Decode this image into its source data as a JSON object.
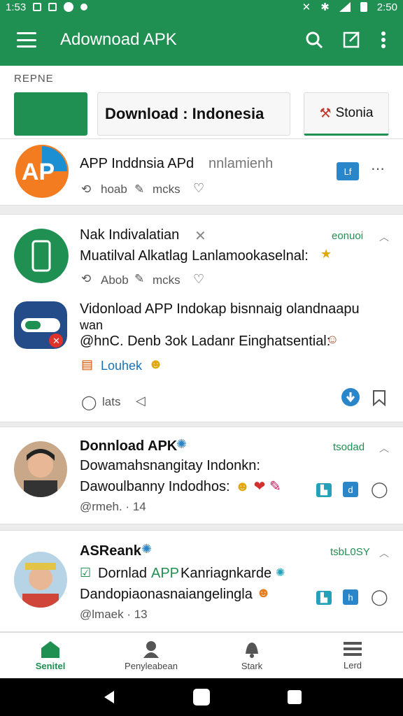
{
  "status_bar": {
    "time": "1:53",
    "clock_right": "2:50"
  },
  "app_bar": {
    "title": "Adownoad APK"
  },
  "section": {
    "label": "REPNE",
    "download_heading": "Download : Indonesia",
    "tab_label": "Stonia"
  },
  "posts": [
    {
      "title": "APP Inddnsia APd",
      "title_suffix": "nnlamienh",
      "meta_left": "hoab",
      "meta_right": "mcks",
      "badge": "Lf"
    },
    {
      "title": "Nak Indivalatian",
      "tag": "eonuoi",
      "body": "Muatilval Alkatlag Lanlamookaselnal:",
      "meta_left": "Abob",
      "meta_right": "mcks"
    },
    {
      "title": "Vidonload APP Indokap bisnnaig olandnaapu",
      "title_line2": "wan",
      "body": "@hnC. Denb 3ok Ladanr Einghatsential:",
      "link": "Louhek",
      "meta_left": "lats"
    },
    {
      "title": "Donnload APK",
      "tag": "tsodad",
      "body1": "Dowamahsnangitay Indonkn:",
      "body2": "Dawoulbanny Indodhos:",
      "handle": "@rmeh. · 14",
      "badge": "d"
    },
    {
      "title": "ASReank",
      "tag": "tsbL0SY",
      "body1_prefix": "Dornlad",
      "body1_green": "APP",
      "body1_rest": "Kanriagnkarde",
      "body2": "Dandopiaonasnaiangelingla",
      "handle": "@lmaek · 13",
      "badge": "h"
    }
  ],
  "bottom_nav": [
    {
      "label": "Senitel"
    },
    {
      "label": "Penyleabean"
    },
    {
      "label": "Stark"
    },
    {
      "label": "Lerd"
    }
  ],
  "colors": {
    "primary": "#1f8f52",
    "teal": "#22a1b8",
    "blue": "#2a86c8"
  }
}
